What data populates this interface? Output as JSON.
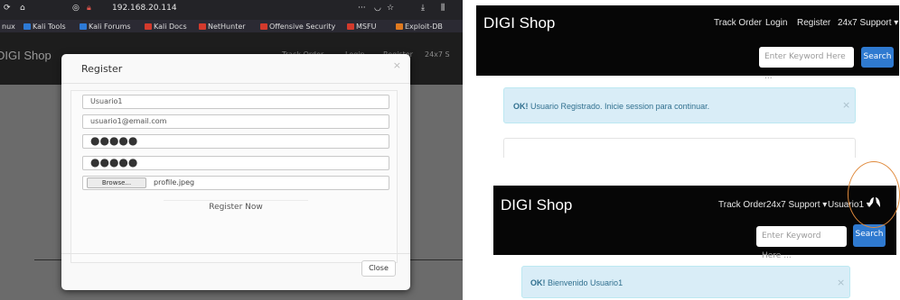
{
  "left": {
    "browser": {
      "url": "192.168.20.114",
      "toolbar_dots": "···",
      "bookmarks": [
        {
          "label": "nux",
          "color": "#2d7ad6"
        },
        {
          "label": "Kali Tools",
          "color": "#2d7ad6"
        },
        {
          "label": "Kali Forums",
          "color": "#2d7ad6"
        },
        {
          "label": "Kali Docs",
          "color": "#d33a2c"
        },
        {
          "label": "NetHunter",
          "color": "#d33a2c"
        },
        {
          "label": "Offensive Security",
          "color": "#d33a2c"
        },
        {
          "label": "MSFU",
          "color": "#d33a2c"
        },
        {
          "label": "Exploit-DB",
          "color": "#e07a1f"
        }
      ]
    },
    "site": {
      "brand": "DIGI Shop",
      "nav": [
        "Track Order",
        "Login",
        "Register",
        "24x7 S"
      ]
    },
    "modal": {
      "title": "Register",
      "close_x": "×",
      "username": "Usuario1",
      "email": "usuario1@email.com",
      "password": "●●●●●",
      "password_confirm": "●●●●●",
      "browse_label": "Browse...",
      "file_name": "profile.jpeg",
      "submit_label": "Register Now",
      "close_label": "Close"
    }
  },
  "right_top": {
    "brand": "DIGI Shop",
    "nav": [
      "Track Order",
      "Login",
      "Register",
      "24x7 Support ▾"
    ],
    "search_placeholder": "Enter Keyword Here ...",
    "search_button": "Search",
    "alert_bold": "OK!",
    "alert_text": "Usuario Registrado. Inicie session para continuar.",
    "alert_close": "×"
  },
  "right_bottom": {
    "brand": "DIGI Shop",
    "nav": [
      "Track Order",
      "24x7 Support ▾",
      "Usuario1 ▾"
    ],
    "search_placeholder": "Enter Keyword Here ...",
    "search_button": "Search",
    "alert_bold": "OK!",
    "alert_text": "Bienvenido Usuario1",
    "alert_close": "×"
  },
  "colors": {
    "accent": "#2f7ad0",
    "alert_bg": "#d9edf7",
    "alert_text": "#31708f",
    "highlight_circle": "#e08a3c"
  }
}
